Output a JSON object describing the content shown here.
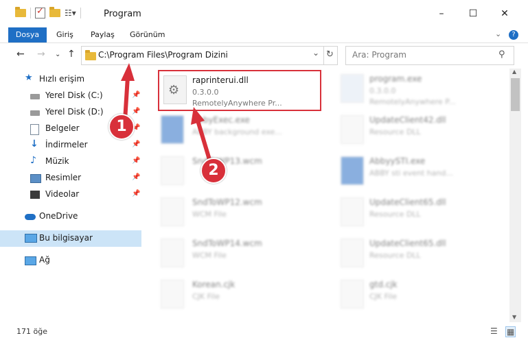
{
  "window": {
    "title": "Program",
    "controls": [
      "–",
      "☐",
      "✕"
    ]
  },
  "ribbon": {
    "tabs": [
      "Dosya",
      "Giriş",
      "Paylaş",
      "Görünüm"
    ],
    "help": "?"
  },
  "address": {
    "path": "C:\\Program Files\\Program Dizini",
    "search_placeholder": "Ara: Program"
  },
  "sidebar": {
    "items": [
      {
        "label": "Hızlı erişim",
        "icon": "star-icon",
        "pinned": false
      },
      {
        "label": "Yerel Disk (C:)",
        "icon": "drive-icon",
        "pinned": true
      },
      {
        "label": "Yerel Disk (D:)",
        "icon": "drive-icon",
        "pinned": true
      },
      {
        "label": "Belgeler",
        "icon": "document-icon",
        "pinned": true
      },
      {
        "label": "İndirmeler",
        "icon": "download-icon",
        "pinned": true
      },
      {
        "label": "Müzik",
        "icon": "music-icon",
        "pinned": true
      },
      {
        "label": "Resimler",
        "icon": "picture-icon",
        "pinned": true
      },
      {
        "label": "Videolar",
        "icon": "video-icon",
        "pinned": true
      },
      {
        "label": "OneDrive",
        "icon": "cloud-icon",
        "pinned": false
      },
      {
        "label": "Bu bilgisayar",
        "icon": "computer-icon",
        "pinned": false
      },
      {
        "label": "Ağ",
        "icon": "network-icon",
        "pinned": false
      }
    ]
  },
  "files": [
    {
      "name": "raprinterui.dll",
      "line1": "0.3.0.0",
      "line2": "RemotelyAnywhere Pr...",
      "highlight": true
    },
    {
      "name": "program.exe",
      "line1": "0.3.0.0",
      "line2": "RemotelyAnywhere P...",
      "highlight": false
    },
    {
      "name": "AbbyExec.exe",
      "line1": "ABBY background exe...",
      "line2": "",
      "highlight": false
    },
    {
      "name": "UpdateClient42.dll",
      "line1": "Resource DLL",
      "line2": "",
      "highlight": false
    },
    {
      "name": "SndToWP13.wcm",
      "line1": "",
      "line2": "",
      "highlight": false
    },
    {
      "name": "AbbyySTI.exe",
      "line1": "ABBY sti event hand...",
      "line2": "",
      "highlight": false
    },
    {
      "name": "SndToWP12.wcm",
      "line1": "WCM File",
      "line2": "",
      "highlight": false
    },
    {
      "name": "UpdateClient65.dll",
      "line1": "Resource DLL",
      "line2": "",
      "highlight": false
    },
    {
      "name": "SndToWP14.wcm",
      "line1": "WCM File",
      "line2": "",
      "highlight": false
    },
    {
      "name": "UpdateClient65.dll",
      "line1": "Resource DLL",
      "line2": "",
      "highlight": false
    },
    {
      "name": "Korean.cjk",
      "line1": "CJK File",
      "line2": "",
      "highlight": false
    },
    {
      "name": "gtd.cjk",
      "line1": "CJK File",
      "line2": "",
      "highlight": false
    }
  ],
  "status": {
    "count": "171 öğe"
  },
  "annotations": {
    "step1": "1",
    "step2": "2",
    "accent": "#d8303a"
  }
}
